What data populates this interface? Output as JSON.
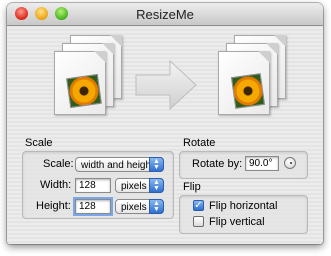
{
  "window": {
    "title": "ResizeMe"
  },
  "scale": {
    "group_label": "Scale",
    "scale_label": "Scale:",
    "scale_value": "width and height",
    "width_label": "Width:",
    "width_value": "128",
    "width_unit": "pixels",
    "height_label": "Height:",
    "height_value": "128",
    "height_unit": "pixels"
  },
  "rotate": {
    "group_label": "Rotate",
    "rotate_by_label": "Rotate by:",
    "rotate_value": "90.0°"
  },
  "flip": {
    "group_label": "Flip",
    "horizontal_label": "Flip horizontal",
    "horizontal_checked": true,
    "vertical_label": "Flip vertical",
    "vertical_checked": false
  },
  "icons": [
    "close-icon",
    "minimize-icon",
    "zoom-icon",
    "image-stack-icon",
    "right-arrow-icon",
    "popup-chevron-icon",
    "rotation-knob-icon",
    "checkmark-icon"
  ]
}
